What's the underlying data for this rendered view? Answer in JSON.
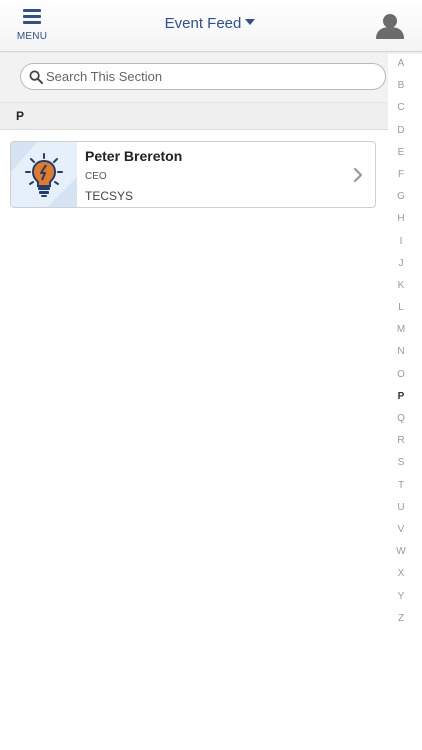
{
  "header": {
    "menu_label": "MENU",
    "title": "Event Feed"
  },
  "search": {
    "placeholder": "Search This Section"
  },
  "section": {
    "letter": "P"
  },
  "attendees": [
    {
      "name": "Peter Brereton",
      "title": "CEO",
      "company": "TECSYS"
    }
  ],
  "index_letters": [
    "A",
    "B",
    "C",
    "D",
    "E",
    "F",
    "G",
    "H",
    "I",
    "J",
    "K",
    "L",
    "M",
    "N",
    "O",
    "P",
    "Q",
    "R",
    "S",
    "T",
    "U",
    "V",
    "W",
    "X",
    "Y",
    "Z"
  ],
  "index_active": "P",
  "colors": {
    "accent": "#2d4f94",
    "bulb_orange": "#e07b2a",
    "bulb_navy": "#1f3d73"
  }
}
